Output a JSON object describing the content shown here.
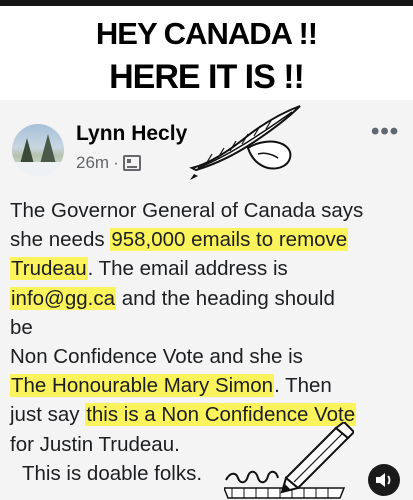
{
  "meme": {
    "line1": "HEY CANADA !!",
    "line2": "HERE IT IS !!"
  },
  "post": {
    "author": "Lynn Hecly",
    "time": "26m",
    "separator": "·",
    "privacy_icon": "globe-image-icon",
    "more_label": "•••",
    "body": {
      "l1": "The Governor General of Canada says",
      "l2a": "she needs ",
      "l2b": "958,000 emails to remove",
      "l3a": "Trudeau",
      "l3b": ". The email address is",
      "l4a": "info@gg.ca",
      "l4b": " and the heading should",
      "l5": "be",
      "l6": "Non Confidence Vote and she is",
      "l7a": "The Honourable Mary Simon",
      "l7b": ". Then",
      "l8a": "just say ",
      "l8b": "this is a Non Confidence Vote",
      "l9": "for Justin Trudeau.",
      "l10": "This is doable folks."
    }
  },
  "colors": {
    "highlight": "#fbf35b",
    "post_background": "#f4f4f4",
    "meta_text": "#65676b"
  },
  "icons": {
    "quill": "quill-pen-icon",
    "pencil": "pencil-writing-icon",
    "sound": "sound-icon"
  }
}
